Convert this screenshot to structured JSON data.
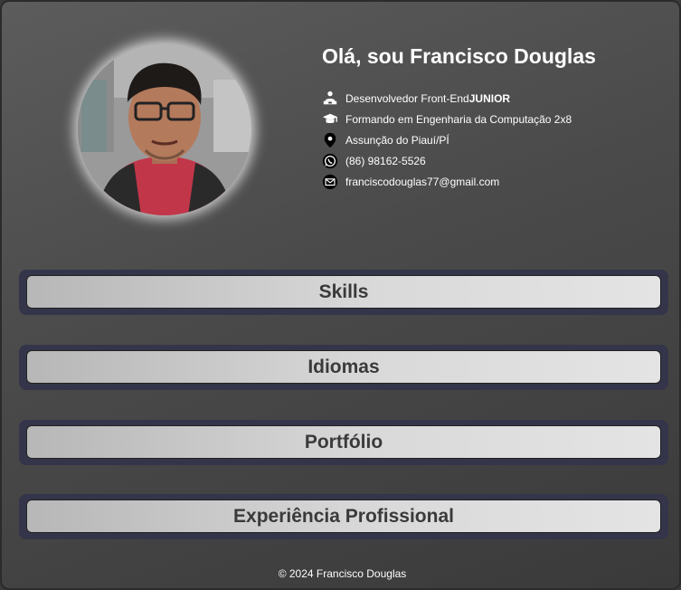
{
  "profile": {
    "heading": "Olá, sou Francisco Douglas",
    "role_prefix": "Desenvolvedor Front-End ",
    "role_level": "JUNIOR",
    "education": "Formando em Engenharia da Computação 2x8",
    "location": "Assunção do Piauí/PÍ",
    "phone": "(86) 98162-5526",
    "email": "franciscodouglas77@gmail.com"
  },
  "icons": {
    "role": "developer-icon",
    "education": "graduation-cap-icon",
    "location": "map-pin-icon",
    "phone": "whatsapp-icon",
    "email": "envelope-icon"
  },
  "sections": {
    "skills": "Skills",
    "languages": "Idiomas",
    "portfolio": "Portfólio",
    "experience": "Experiência Profissional"
  },
  "footer": {
    "text": "© 2024 Francisco Douglas"
  },
  "colors": {
    "section_frame": "#34344a",
    "button_text": "#3a3a3a",
    "text": "#ffffff"
  }
}
